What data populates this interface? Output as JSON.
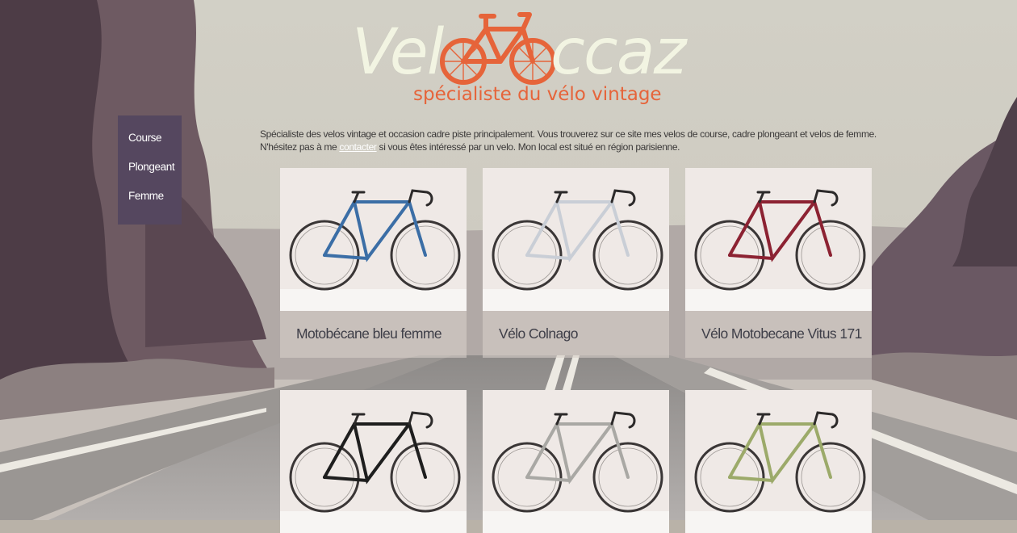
{
  "brand": {
    "logo_left": "Vel",
    "logo_right": "ccaz",
    "tagline": "spécialiste du vélo vintage",
    "logo_cream": "#f2f4e2",
    "logo_orange": "#e6643a"
  },
  "menu": {
    "bg_color": "#55475f",
    "items": [
      {
        "label": "Course"
      },
      {
        "label": "Plongeant"
      },
      {
        "label": "Femme"
      }
    ]
  },
  "intro": {
    "text_before_link": "Spécialiste des velos vintage et occasion cadre piste principalement. Vous trouverez sur ce site mes velos de course, cadre plongeant et velos de femme. N'hésitez pas à me ",
    "link_text": "contacter",
    "text_after_link": " si vous êtes intéressé par un velo. Mon local est situé en région parisienne."
  },
  "products": [
    {
      "title": "Motobécane bleu femme",
      "frame_color": "#3b6ea6",
      "icon": "bicycle-photo"
    },
    {
      "title": "Vélo Colnago",
      "frame_color": "#c9ced6",
      "icon": "bicycle-photo"
    },
    {
      "title": "Vélo Motobecane Vitus 171",
      "frame_color": "#8c2232",
      "icon": "bicycle-photo"
    },
    {
      "title": "",
      "frame_color": "#1e1e1e",
      "icon": "bicycle-photo"
    },
    {
      "title": "",
      "frame_color": "#a9a8a4",
      "icon": "bicycle-photo"
    },
    {
      "title": "",
      "frame_color": "#9caa6a",
      "icon": "bicycle-photo"
    }
  ]
}
